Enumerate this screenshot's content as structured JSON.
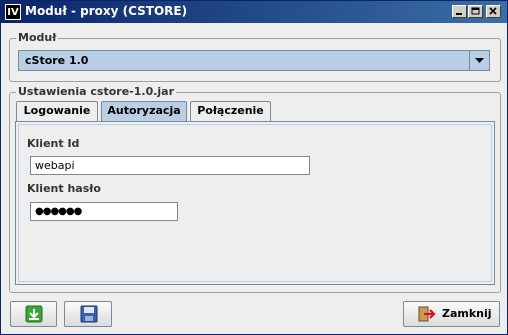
{
  "window": {
    "app_icon_text": "IV",
    "title": "Moduł - proxy (CSTORE)"
  },
  "module_group": {
    "title": "Moduł",
    "selected_module": "cStore 1.0"
  },
  "settings_group": {
    "title": "Ustawienia cstore-1.0.jar",
    "tabs": [
      {
        "label": "Logowanie",
        "active": false
      },
      {
        "label": "Autoryzacja",
        "active": true
      },
      {
        "label": "Połączenie",
        "active": false
      }
    ],
    "client_id_label": "Klient Id",
    "client_id_value": "webapi",
    "client_password_label": "Klient hasło",
    "client_password_value": "●●●●●●"
  },
  "footer": {
    "import_icon": "download-icon",
    "save_icon": "floppy-disk-icon",
    "close_label": "Zamknij",
    "close_icon": "exit-door-icon"
  }
}
